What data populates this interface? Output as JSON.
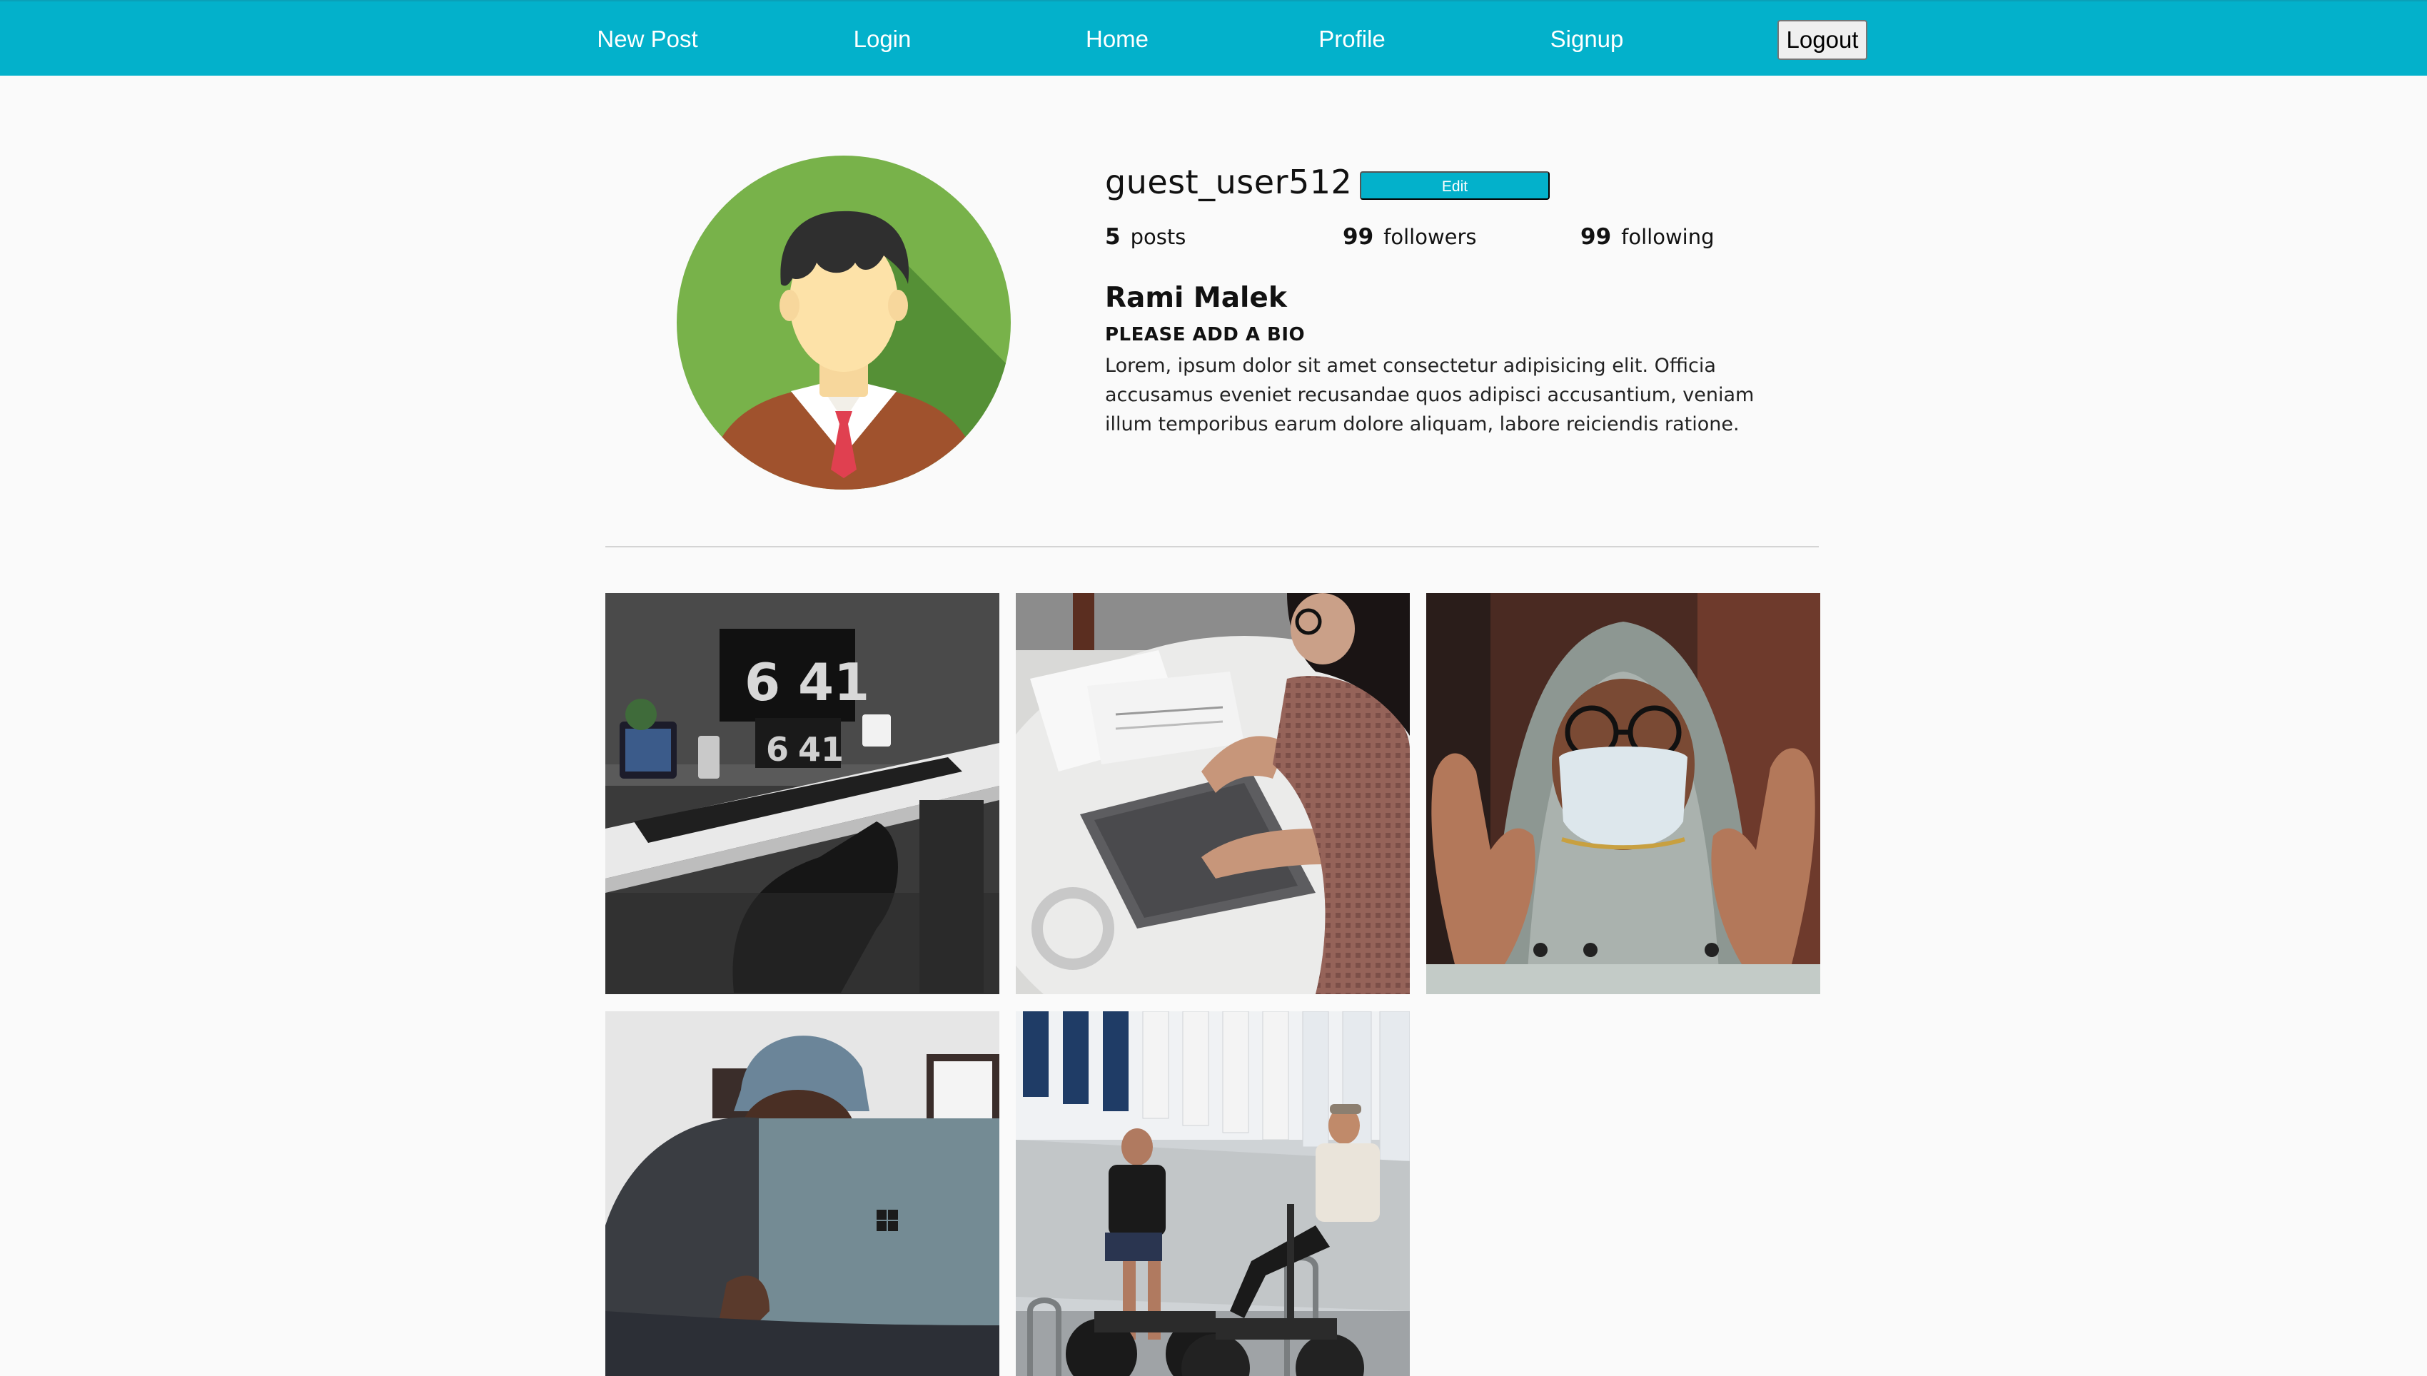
{
  "nav": {
    "links": [
      "New Post",
      "Login",
      "Home",
      "Profile",
      "Signup"
    ],
    "logout_label": "Logout"
  },
  "profile": {
    "username": "guest_user512",
    "edit_label": "Edit",
    "stats": [
      {
        "count": "5",
        "label": "posts"
      },
      {
        "count": "99",
        "label": "followers"
      },
      {
        "count": "99",
        "label": "following"
      }
    ],
    "display_name": "Rami Malek",
    "bio_title": "PLEASE ADD A BIO",
    "bio_text": "Lorem, ipsum dolor sit amet consectetur adipisicing elit. Officia accusamus eveniet recusandae quos adipisci accusantium, veniam illum temporibus earum dolore aliquam, labore reiciendis ratione."
  },
  "photo_text": {
    "clock_main_hour": "6",
    "clock_main_min": "41",
    "clock_screen_hour": "6",
    "clock_screen_min": "41"
  },
  "colors": {
    "brand": "#03b1cb",
    "avatar_bg": "#78b24a"
  },
  "posts": [
    {
      "name": "desk-setup-photo"
    },
    {
      "name": "woman-laptop-photo"
    },
    {
      "name": "man-mask-photo"
    },
    {
      "name": "laptop-beanie-photo"
    },
    {
      "name": "scooter-men-photo"
    }
  ]
}
